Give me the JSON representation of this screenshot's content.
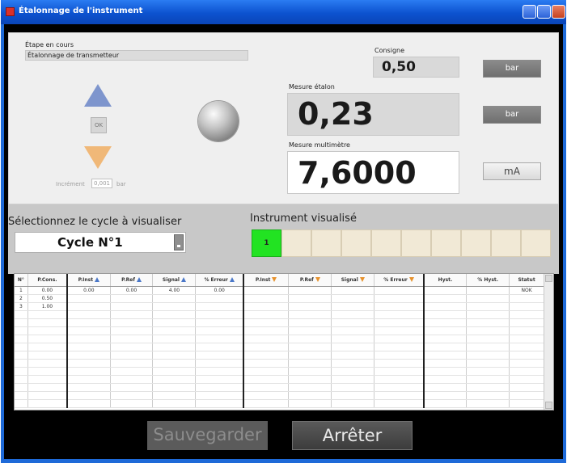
{
  "window": {
    "title": "Étalonnage de l'instrument",
    "colors": {
      "titlebar": "#0c52cf",
      "close_button": "#c6421f"
    }
  },
  "step": {
    "label": "Étape en cours",
    "value": "Étalonnage de transmetteur"
  },
  "controls": {
    "ok_label": "OK",
    "increment_label": "Incrément",
    "increment_value": "0,001",
    "increment_unit": "bar",
    "arrow_up_icon": "arrow-up-icon",
    "arrow_down_icon": "arrow-down-icon"
  },
  "setpoint": {
    "label": "Consigne",
    "value": "0,50",
    "unit": "bar"
  },
  "standard": {
    "label": "Mesure étalon",
    "value": "0,23",
    "unit": "bar"
  },
  "multimeter": {
    "label": "Mesure multimètre",
    "value": "7,6000",
    "unit": "mA"
  },
  "cycle": {
    "label": "Sélectionnez le cycle à visualiser",
    "selected": "Cycle N°1"
  },
  "instrument": {
    "label": "Instrument visualisé",
    "cells": [
      "1",
      "",
      "",
      "",
      "",
      "",
      "",
      "",
      "",
      ""
    ],
    "active_color": "#22e322"
  },
  "table": {
    "headers": [
      "N°",
      "P.Cons.",
      "P.Inst",
      "P.Ref",
      "Signal",
      "% Erreur",
      "P.Inst",
      "P.Ref",
      "Signal",
      "% Erreur",
      "Hyst.",
      "% Hyst.",
      "Statut"
    ],
    "rows": [
      [
        "1",
        "0.00",
        "0.00",
        "0.00",
        "4.00",
        "0.00",
        "",
        "",
        "",
        "",
        "",
        "",
        "NOK"
      ],
      [
        "2",
        "0.50",
        "",
        "",
        "",
        "",
        "",
        "",
        "",
        "",
        "",
        "",
        ""
      ],
      [
        "3",
        "1.00",
        "",
        "",
        "",
        "",
        "",
        "",
        "",
        "",
        "",
        "",
        ""
      ]
    ],
    "empty_rows": 12
  },
  "buttons": {
    "save": "Sauvegarder",
    "stop": "Arrêter"
  }
}
